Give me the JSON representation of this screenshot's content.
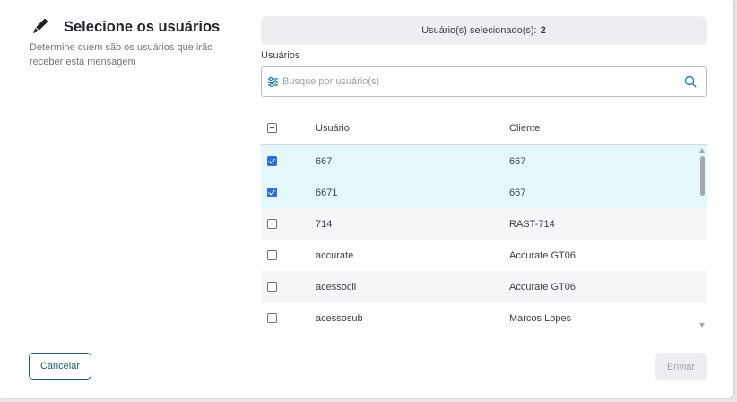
{
  "header": {
    "title": "Selecione os usuários",
    "description": "Determine quem são os usuários que irão receber esta mensagem",
    "icon": "pen-icon"
  },
  "selection": {
    "label": "Usuário(s) selecionado(s):",
    "count": "2"
  },
  "search": {
    "label": "Usuários",
    "placeholder": "Busque por usuário(s)",
    "value": ""
  },
  "table": {
    "columns": {
      "user": "Usuário",
      "client": "Cliente"
    },
    "header_checkbox_state": "indeterminate",
    "rows": [
      {
        "user": "667",
        "client": "667",
        "checked": true
      },
      {
        "user": "6671",
        "client": "667",
        "checked": true
      },
      {
        "user": "714",
        "client": "RAST-714",
        "checked": false
      },
      {
        "user": "accurate",
        "client": "Accurate GT06",
        "checked": false
      },
      {
        "user": "acessocli",
        "client": "Accurate GT06",
        "checked": false
      },
      {
        "user": "acessosub",
        "client": "Marcos Lopes",
        "checked": false
      }
    ]
  },
  "footer": {
    "cancel_label": "Cancelar",
    "send_label": "Enviar"
  },
  "colors": {
    "accent": "#1e5b6e",
    "checkbox_checked": "#2f6fd6",
    "selected_row": "#e4f7fa"
  }
}
